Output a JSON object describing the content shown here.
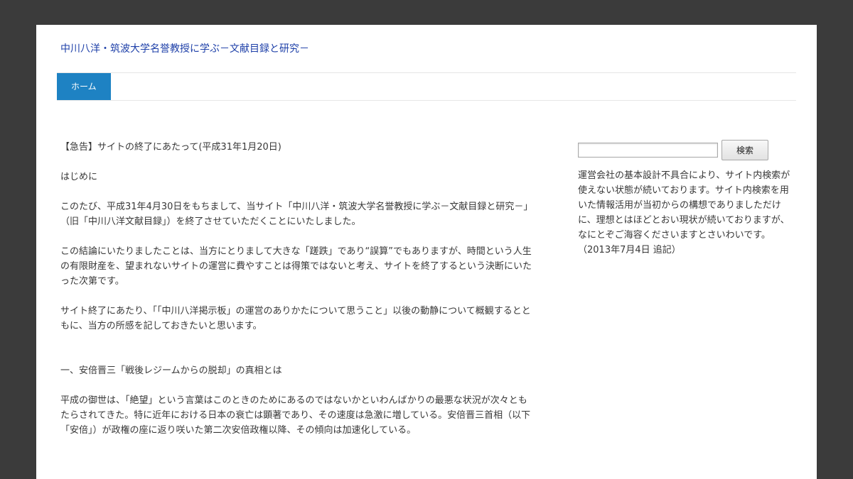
{
  "header": {
    "site_title": "中川八洋・筑波大学名誉教授に学ぶ－文献目録と研究－"
  },
  "nav": {
    "items": [
      {
        "label": "ホーム"
      }
    ]
  },
  "article": {
    "paragraphs": [
      "【急告】サイトの終了にあたって(平成31年1月20日)",
      "はじめに",
      "このたび、平成31年4月30日をもちまして、当サイト「中川八洋・筑波大学名誉教授に学ぶ－文献目録と研究－」（旧「中川八洋文献目録」）を終了させていただくことにいたしました。",
      "この結論にいたりましたことは、当方にとりまして大きな「蹉跌」であり“誤算”でもありますが、時間という人生の有限財産を、望まれないサイトの運営に費やすことは得策ではないと考え、サイトを終了するという決断にいたった次第です。",
      "サイト終了にあたり、「「中川八洋掲示板」の運営のありかたについて思うこと」以後の動静について概観するとともに、当方の所感を記しておきたいと思います。",
      "一、安倍晋三「戦後レジームからの脱却」の真相とは",
      "平成の御世は、「絶望」という言葉はこのときのためにあるのではないかといわんばかりの最悪な状況が次々ともたらされてきた。特に近年における日本の衰亡は顕著であり、その速度は急激に増している。安倍晋三首相（以下「安倍」）が政権の座に返り咲いた第二次安倍政権以降、その傾向は加速化している。"
    ]
  },
  "sidebar": {
    "search_placeholder": "",
    "search_button_label": "検索",
    "notice": "運営会社の基本設計不具合により、サイト内検索が使えない状態が続いております。サイト内検索を用いた情報活用が当初からの構想でありましただけに、理想とはほどとおい現状が続いておりますが、なにとぞご海容くださいますとさいわいです。（2013年7月4日 追記）"
  }
}
